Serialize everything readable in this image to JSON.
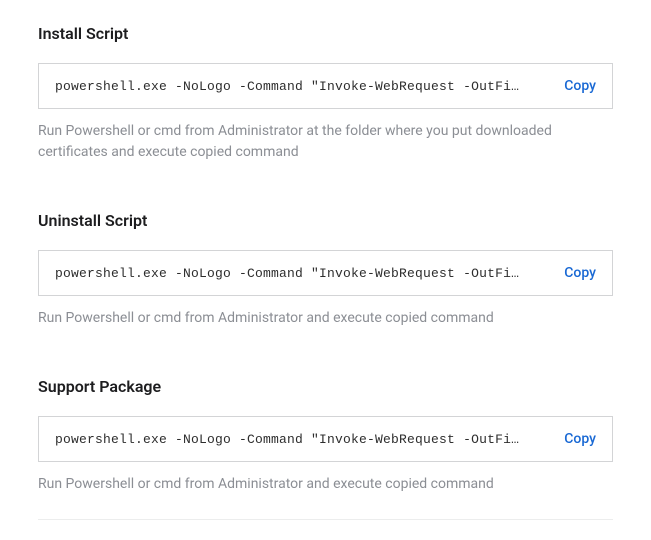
{
  "sections": [
    {
      "heading": "Install Script",
      "code": "powershell.exe -NoLogo -Command \"Invoke-WebRequest -OutFi…",
      "hint": "Run Powershell or cmd from Administrator at the folder where you put downloaded certificates and execute copied command",
      "copy_label": "Copy"
    },
    {
      "heading": "Uninstall Script",
      "code": "powershell.exe -NoLogo -Command \"Invoke-WebRequest -OutFi…",
      "hint": "Run Powershell or cmd from Administrator and execute copied command",
      "copy_label": "Copy"
    },
    {
      "heading": "Support Package",
      "code": "powershell.exe -NoLogo -Command \"Invoke-WebRequest -OutFi…",
      "hint": "Run Powershell or cmd from Administrator and execute copied command",
      "copy_label": "Copy"
    }
  ]
}
